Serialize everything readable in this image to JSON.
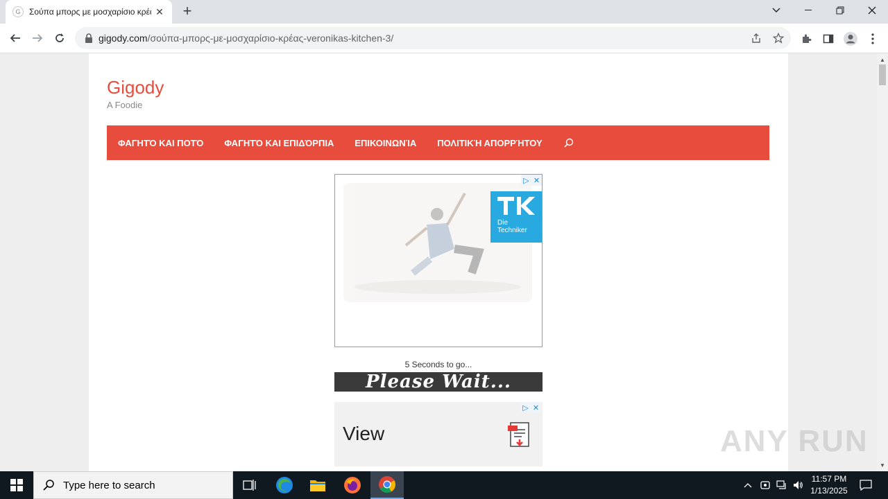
{
  "browser": {
    "tab_title": "Σούπα μπορς με μοσχαρίσιο κρέας - veronikas kitchen",
    "tab_favicon_letter": "G",
    "url_host": "gigody.com",
    "url_path": "/σούπα-μπορς-με-μοσχαρίσιο-κρέας-veronikas-kitchen-3/"
  },
  "site": {
    "title": "Gigody",
    "description": "A Foodie",
    "menu": [
      {
        "label": "ΦΑΓΗΤΌ ΚΑΙ ΠΟΤΌ"
      },
      {
        "label": "ΦΑΓΗΤΌ ΚΑΙ ΕΠΙΔΌΡΠΙΑ"
      },
      {
        "label": "ΕΠΙΚΟΙΝΩΝΊΑ"
      },
      {
        "label": "ΠΟΛΙΤΙΚΉ ΑΠΟΡΡΉΤΟΥ"
      }
    ],
    "accent_color": "#e74c3c"
  },
  "ad1": {
    "logo_line1": "Die",
    "logo_line2": "Techniker"
  },
  "countdown": {
    "text": "5 Seconds to go...",
    "banner": "Please Wait..."
  },
  "ad2": {
    "text": "View"
  },
  "watermark": "ANY RUN",
  "taskbar": {
    "search_placeholder": "Type here to search",
    "time": "11:57 PM",
    "date": "1/13/2025"
  }
}
